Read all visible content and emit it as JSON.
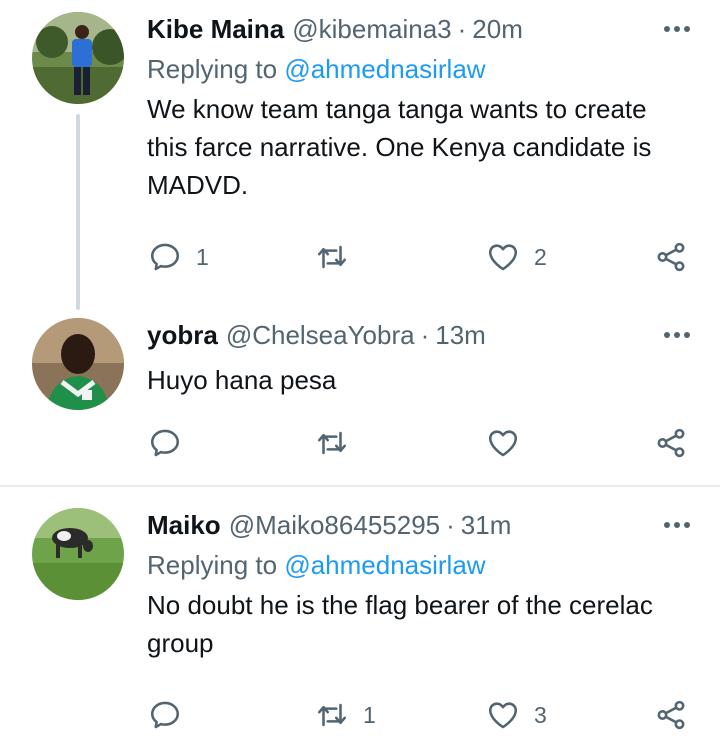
{
  "tweets": [
    {
      "name": "Kibe Maina",
      "handle": "@kibemaina3",
      "separator": "·",
      "time": "20m",
      "replying_prefix": "Replying to",
      "replying_to": "@ahmednasirlaw",
      "text": "We know team tanga tanga wants to create this farce narrative. One Kenya candidate is MADVD.",
      "reply_count": "1",
      "retweet_count": "",
      "like_count": "2"
    },
    {
      "name": "yobra",
      "handle": "@ChelseaYobra",
      "separator": "·",
      "time": "13m",
      "text": "Huyo hana pesa",
      "reply_count": "",
      "retweet_count": "",
      "like_count": ""
    },
    {
      "name": "Maiko",
      "handle": "@Maiko86455295",
      "separator": "·",
      "time": "31m",
      "replying_prefix": "Replying to",
      "replying_to": "@ahmednasirlaw",
      "text": "No doubt he is the flag bearer of the cerelac group",
      "reply_count": "",
      "retweet_count": "1",
      "like_count": "3"
    }
  ],
  "icons": {
    "reply": "reply-icon",
    "retweet": "retweet-icon",
    "like": "heart-icon",
    "share": "share-icon",
    "more": "more-options-icon"
  },
  "colors": {
    "text": "#0f1419",
    "secondary": "#536471",
    "link": "#1d9bf0",
    "thread_line": "#cfd9de",
    "divider": "#e6ecf0"
  }
}
